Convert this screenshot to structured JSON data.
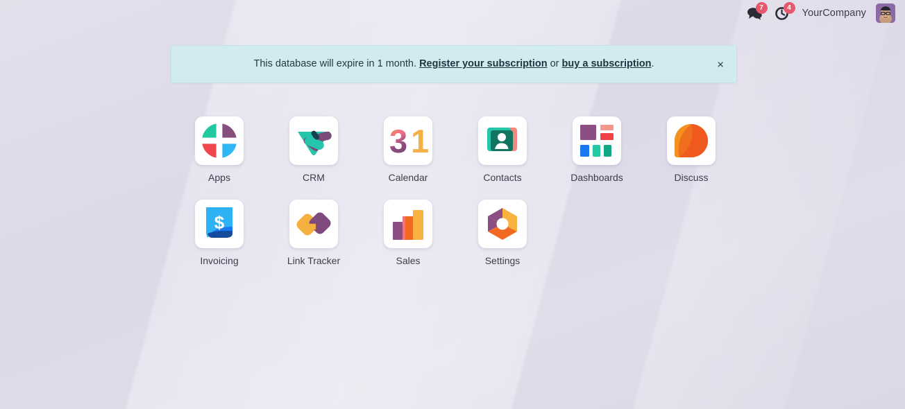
{
  "topbar": {
    "messages": {
      "icon": "speech-bubbles-icon",
      "count": "7"
    },
    "activities": {
      "icon": "clock-activity-icon",
      "count": "4"
    },
    "company": "YourCompany",
    "avatar": {
      "icon": "user-avatar-icon"
    }
  },
  "banner": {
    "text_before": "This database will expire in 1 month.",
    "link_register": "Register your subscription",
    "text_middle": "or",
    "link_buy": "buy a subscription",
    "text_after": ".",
    "close_label": "×",
    "background_color": "#d2ebef",
    "text_color": "#203b43"
  },
  "apps": {
    "rows": [
      [
        {
          "label": "Apps",
          "icon": "apps-pie-icon"
        },
        {
          "label": "CRM",
          "icon": "crm-handshake-icon"
        },
        {
          "label": "Calendar",
          "icon": "calendar-31-icon"
        },
        {
          "label": "Contacts",
          "icon": "contacts-card-icon"
        },
        {
          "label": "Dashboards",
          "icon": "dashboards-blocks-icon"
        },
        {
          "label": "Discuss",
          "icon": "discuss-bubble-icon"
        }
      ],
      [
        {
          "label": "Invoicing",
          "icon": "invoicing-dollar-doc-icon"
        },
        {
          "label": "Link Tracker",
          "icon": "link-tracker-chain-icon"
        },
        {
          "label": "Sales",
          "icon": "sales-bars-icon"
        },
        {
          "label": "Settings",
          "icon": "settings-hexagon-icon"
        }
      ]
    ]
  },
  "theme": {
    "background_base": "#dedbe9",
    "badge_color": "#e6586e",
    "tile_color": "#ffffff"
  }
}
